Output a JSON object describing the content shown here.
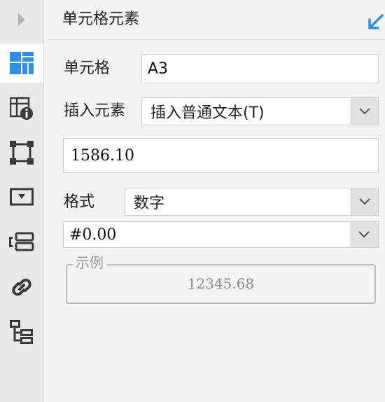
{
  "panel": {
    "title": "单元格元素"
  },
  "cell": {
    "label": "单元格",
    "value": "A3"
  },
  "insert": {
    "label": "插入元素",
    "selected": "插入普通文本(T)"
  },
  "content": {
    "value": "1586.10"
  },
  "format": {
    "label": "格式",
    "selected": "数字",
    "pattern": "#0.00"
  },
  "example": {
    "legend": "示例",
    "value": "12345.68"
  },
  "colors": {
    "accent": "#2f8fe6",
    "active_icon": "#2f8fe6",
    "icon": "#3a3a3a"
  },
  "rail": {
    "items": [
      "cell-element-icon",
      "cell-attributes-icon",
      "cell-style-icon",
      "widget-icon",
      "condition-icon",
      "hyperlink-icon",
      "data-tree-icon"
    ]
  }
}
